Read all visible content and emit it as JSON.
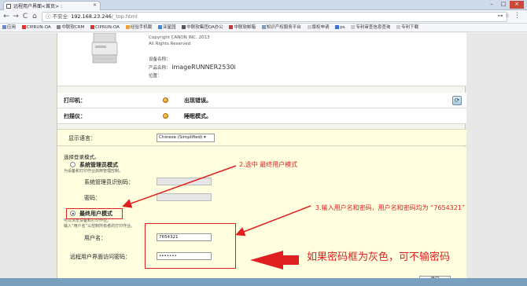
{
  "browser": {
    "tab_title": "远程用户界面<首页> : ",
    "tab_close": "×",
    "window_controls": [
      "–",
      "□",
      "×"
    ],
    "nav": {
      "back": "←",
      "forward": "→",
      "reload": "C",
      "home": "⌂"
    },
    "url_secure_label": "ⓘ 不安全",
    "url_host": "192.168.23.246",
    "url_path": "/_top.html",
    "url_right_icons": "⊶ ☆",
    "menu": "⋮",
    "bookmarks": [
      "应用",
      "CIPRUN-OA",
      "中联软CRM",
      "CIPRUN-OA",
      "经验手机载",
      "亚星园",
      "中联软集团OA办公",
      "中联软邮箱",
      "知识产权服务平台",
      "版权申请",
      "ps",
      "专利审查信息查询",
      "专利下载"
    ]
  },
  "device": {
    "copyright_line1": "Copyright CANON INC. 2013",
    "copyright_line2": "All Rights Reserved",
    "device_name_label": "设备名称：",
    "product_name_label": "产品名称：",
    "product_name": "imageRUNNER2530i",
    "location_label": "位置："
  },
  "status": {
    "printer_label": "打印机：",
    "printer_msg": "出现错误。",
    "scanner_label": "扫描仪：",
    "scanner_msg": "睡眠模式。",
    "refresh": "⟳"
  },
  "language": {
    "label": "显示语言：",
    "selected": "Chinese (Simplified)  ▾"
  },
  "login": {
    "title": "选择登录模式。",
    "admin_mode_label": "系统管理员模式",
    "admin_mode_desc": "为设备和打印作业启用管理控制。",
    "admin_id_label": "系统管理员识别码：",
    "password_label": "密码：",
    "user_mode_label": "最终用户模式",
    "user_mode_desc1": "可以浏览设备和打印作业。",
    "user_mode_desc2": "输入“用户名”以控制所有者的打印作业。",
    "username_label": "用户名：",
    "username_value": "7654321",
    "remote_pwd_label": "远程用户界面访问密码：",
    "remote_pwd_value": "•••••••",
    "confirm_button": "确定"
  },
  "annotations": {
    "step2": "2.选中 最终用户模式",
    "step3": "3.输入用户名和密码，用户名和密码均为 “7654321”",
    "note": "如果密码框为灰色，可不输密码",
    "color": "#e02020"
  }
}
